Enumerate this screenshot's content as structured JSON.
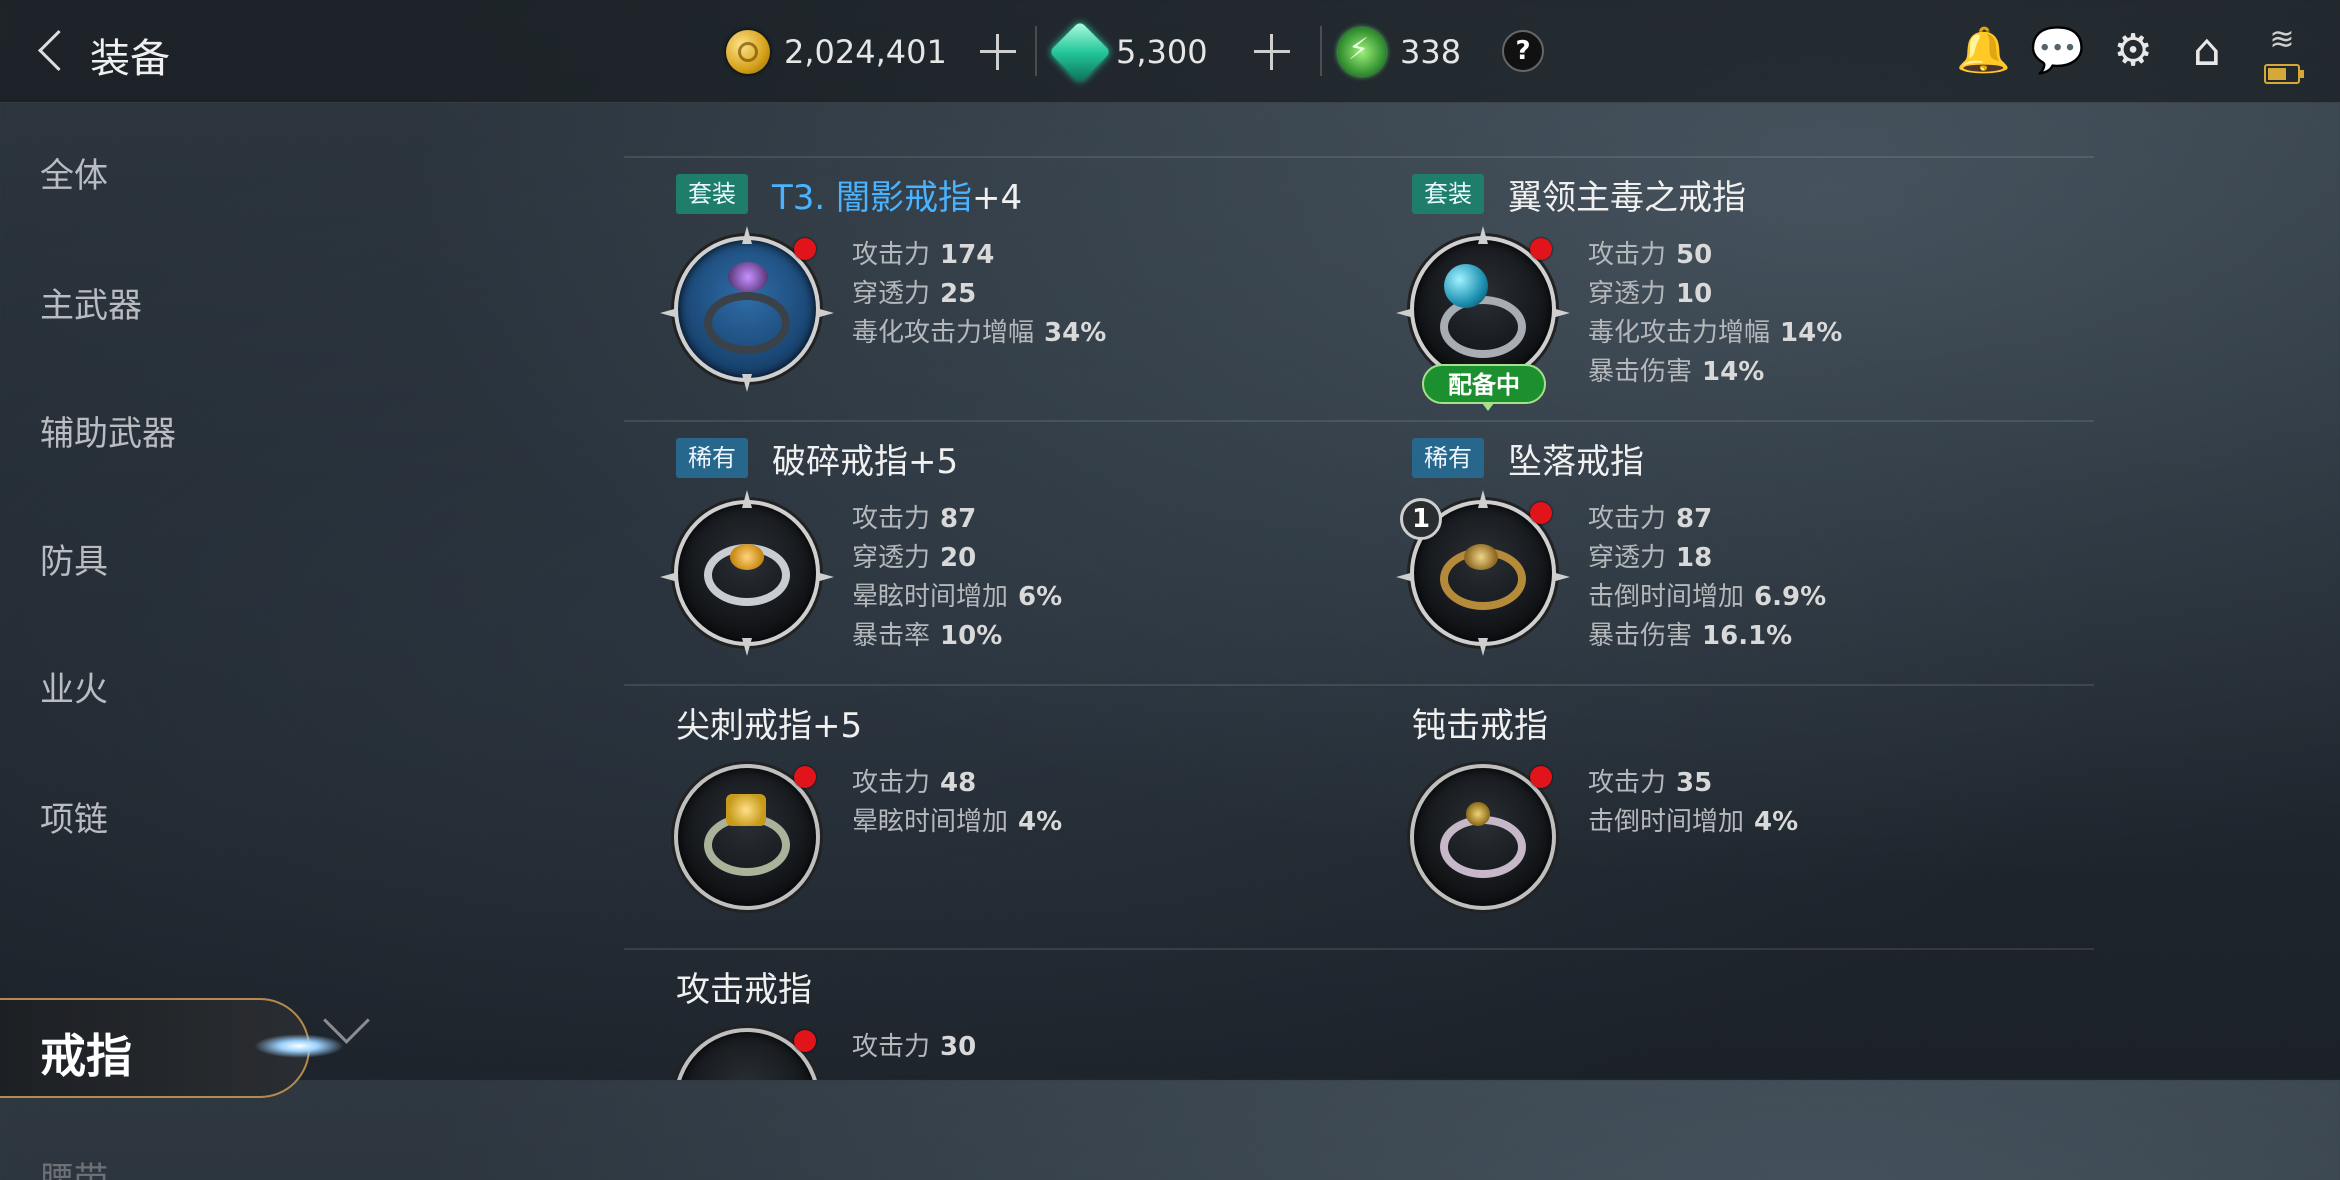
{
  "header": {
    "title": "装备",
    "gold": "2,024,401",
    "gems": "5,300",
    "energy": "338",
    "help": "?"
  },
  "sidebar": {
    "items": [
      "全体",
      "主武器",
      "辅助武器",
      "防具",
      "业火",
      "项链",
      "戒指",
      "腰带"
    ],
    "active": "戒指",
    "cut_text": "腰带"
  },
  "items": [
    {
      "badge": "套装",
      "badge_type": "set",
      "name": "T3. 闇影戒指",
      "name_suffix": "+4",
      "name_color": "#49b3ff",
      "stats": [
        {
          "label": "攻击力",
          "value": "174"
        },
        {
          "label": "穿透力",
          "value": "25"
        },
        {
          "label": "毒化攻击力增幅",
          "value": "34%"
        }
      ],
      "icon": "shadow-ring-icon",
      "equipped": false
    },
    {
      "badge": "套装",
      "badge_type": "set",
      "name": "翼领主毒之戒指",
      "name_suffix": "",
      "stats": [
        {
          "label": "攻击力",
          "value": "50"
        },
        {
          "label": "穿透力",
          "value": "10"
        },
        {
          "label": "毒化攻击力增幅",
          "value": "14%"
        },
        {
          "label": "暴击伤害",
          "value": "14%"
        }
      ],
      "icon": "poison-ring-icon",
      "equipped": true,
      "equipped_label": "配备中"
    },
    {
      "badge": "稀有",
      "badge_type": "rare",
      "name": "破碎戒指",
      "name_suffix": "+5",
      "stats": [
        {
          "label": "攻击力",
          "value": "87"
        },
        {
          "label": "穿透力",
          "value": "20"
        },
        {
          "label": "晕眩时间增加",
          "value": "6%"
        },
        {
          "label": "暴击率",
          "value": "10%"
        }
      ],
      "icon": "broken-ring-icon",
      "equipped": false
    },
    {
      "badge": "稀有",
      "badge_type": "rare",
      "name": "坠落戒指",
      "name_suffix": "",
      "count": "1",
      "stats": [
        {
          "label": "攻击力",
          "value": "87"
        },
        {
          "label": "穿透力",
          "value": "18"
        },
        {
          "label": "击倒时间增加",
          "value": "6.9%"
        },
        {
          "label": "暴击伤害",
          "value": "16.1%"
        }
      ],
      "icon": "fallen-ring-icon",
      "equipped": false
    },
    {
      "badge": "",
      "name": "尖刺戒指",
      "name_suffix": "+5",
      "stats": [
        {
          "label": "攻击力",
          "value": "48"
        },
        {
          "label": "晕眩时间增加",
          "value": "4%"
        }
      ],
      "icon": "spike-ring-icon",
      "equipped": false
    },
    {
      "badge": "",
      "name": "钝击戒指",
      "name_suffix": "",
      "stats": [
        {
          "label": "攻击力",
          "value": "35"
        },
        {
          "label": "击倒时间增加",
          "value": "4%"
        }
      ],
      "icon": "blunt-ring-icon",
      "equipped": false
    },
    {
      "badge": "",
      "name": "攻击戒指",
      "name_suffix": "",
      "stats": [
        {
          "label": "攻击力",
          "value": "30"
        }
      ],
      "icon": "attack-ring-icon",
      "equipped": false
    }
  ]
}
